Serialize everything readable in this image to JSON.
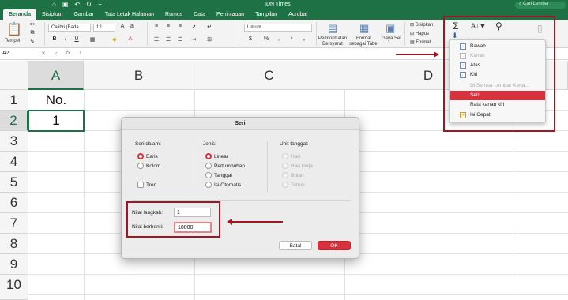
{
  "titlebar": {
    "title": "IDN Times",
    "search_placeholder": "Cari Lembar",
    "accent": "#1e7145"
  },
  "tabs": [
    "Beranda",
    "Sisipkan",
    "Gambar",
    "Tata Letak Halaman",
    "Rumus",
    "Data",
    "Peninjauan",
    "Tampilan",
    "Acrobat"
  ],
  "ribbon": {
    "paste_label": "Tempel",
    "font_name": "Calibri (Bada...",
    "font_size": "12",
    "number_format": "Umum",
    "conditional_label_1": "Pemformatan",
    "conditional_label_2": "Bersyarat",
    "format_table_1": "Format",
    "format_table_2": "sebagai Tabel",
    "cell_styles_label": "Gaya Sel",
    "insert_label": "Sisipkan",
    "delete_label": "Hapus",
    "format_label": "Format"
  },
  "formula": {
    "name_box": "A2",
    "value": "1"
  },
  "grid": {
    "columns": [
      "A",
      "B",
      "C",
      "D"
    ],
    "rows": [
      "1",
      "2",
      "3",
      "4",
      "5",
      "6",
      "7",
      "8",
      "9",
      "10"
    ],
    "cell_a1": "No.",
    "cell_a2": "1"
  },
  "fill_menu": {
    "items": [
      {
        "label": "Bawah",
        "enabled": true
      },
      {
        "label": "Kanan",
        "enabled": false
      },
      {
        "label": "Atas",
        "enabled": true
      },
      {
        "label": "Kiri",
        "enabled": true
      },
      {
        "label": "Di Semua Lembar Kerja...",
        "enabled": false
      },
      {
        "label": "Seri...",
        "enabled": true,
        "highlighted": true
      },
      {
        "label": "Rata kanan kiri",
        "enabled": true
      },
      {
        "label": "Isi Cepat",
        "enabled": true
      }
    ]
  },
  "dialog": {
    "title": "Seri",
    "series_in": {
      "title": "Seri dalam:",
      "options": [
        "Baris",
        "Kolom"
      ],
      "selected": "Baris"
    },
    "trend_label": "Tren",
    "type": {
      "title": "Jenis:",
      "options": [
        "Linear",
        "Pertumbuhan",
        "Tanggal",
        "Isi Otomatis"
      ],
      "selected": "Linear"
    },
    "date_unit": {
      "title": "Unit tanggal:",
      "options": [
        "Hari",
        "Hari kerja",
        "Bulan",
        "Tahun"
      ]
    },
    "step_label": "Nilai langkah:",
    "step_value": "1",
    "stop_label": "Nilai berhenti:",
    "stop_value": "10000",
    "cancel_label": "Batal",
    "ok_label": "OK"
  }
}
